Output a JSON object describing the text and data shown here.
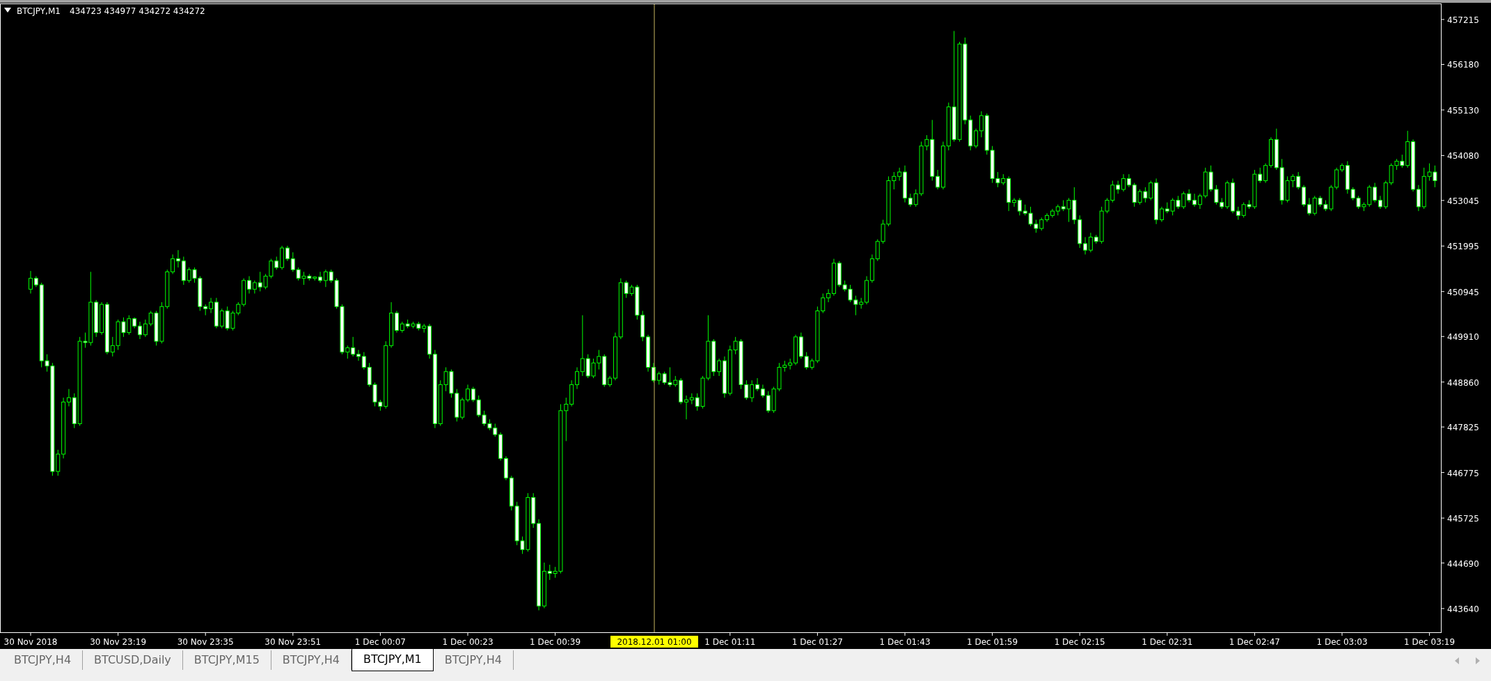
{
  "chart": {
    "symbol": "BTCJPY,M1",
    "ohlc": "434723 434977 434272 434272",
    "crosshair": {
      "time_label": "2018.12.01 01:00"
    },
    "chart_data": {
      "type": "candlestick",
      "categories": [
        "30 Nov 2018",
        null,
        null,
        null,
        null,
        null,
        null,
        null,
        null,
        null,
        null,
        null,
        null,
        null,
        null,
        null,
        "30 Nov 23:19",
        null,
        null,
        null,
        null,
        null,
        null,
        null,
        null,
        null,
        null,
        null,
        null,
        null,
        null,
        null,
        "30 Nov 23:35",
        null,
        null,
        null,
        null,
        null,
        null,
        null,
        null,
        null,
        null,
        null,
        null,
        null,
        null,
        null,
        "30 Nov 23:51",
        null,
        null,
        null,
        null,
        null,
        null,
        null,
        null,
        null,
        null,
        null,
        null,
        null,
        null,
        null,
        "1 Dec 00:07",
        null,
        null,
        null,
        null,
        null,
        null,
        null,
        null,
        null,
        null,
        null,
        null,
        null,
        null,
        null,
        "1 Dec 00:23",
        null,
        null,
        null,
        null,
        null,
        null,
        null,
        null,
        null,
        null,
        null,
        null,
        null,
        null,
        null,
        "1 Dec 00:39",
        null,
        null,
        null,
        null,
        null,
        null,
        null,
        null,
        null,
        null,
        null,
        null,
        null,
        null,
        null,
        null,
        null,
        null,
        null,
        null,
        null,
        null,
        null,
        null,
        null,
        null,
        null,
        null,
        null,
        null,
        null,
        "1 Dec 01:11",
        null,
        null,
        null,
        null,
        null,
        null,
        null,
        null,
        null,
        null,
        null,
        null,
        null,
        null,
        null,
        "1 Dec 01:27",
        null,
        null,
        null,
        null,
        null,
        null,
        null,
        null,
        null,
        null,
        null,
        null,
        null,
        null,
        null,
        "1 Dec 01:43",
        null,
        null,
        null,
        null,
        null,
        null,
        null,
        null,
        null,
        null,
        null,
        null,
        null,
        null,
        null,
        "1 Dec 01:59",
        null,
        null,
        null,
        null,
        null,
        null,
        null,
        null,
        null,
        null,
        null,
        null,
        null,
        null,
        null,
        "1 Dec 02:15",
        null,
        null,
        null,
        null,
        null,
        null,
        null,
        null,
        null,
        null,
        null,
        null,
        null,
        null,
        null,
        "1 Dec 02:31",
        null,
        null,
        null,
        null,
        null,
        null,
        null,
        null,
        null,
        null,
        null,
        null,
        null,
        null,
        null,
        "1 Dec 02:47",
        null,
        null,
        null,
        null,
        null,
        null,
        null,
        null,
        null,
        null,
        null,
        null,
        null,
        null,
        null,
        "1 Dec 03:03",
        null,
        null,
        null,
        null,
        null,
        null,
        null,
        null,
        null,
        null,
        null,
        null,
        null,
        null,
        null,
        "1 Dec 03:19",
        null
      ],
      "ohlc": [
        [
          451000,
          451420,
          450900,
          451250
        ],
        [
          451250,
          451300,
          451050,
          451100
        ],
        [
          451100,
          451150,
          449200,
          449350
        ],
        [
          449350,
          449500,
          449100,
          449230
        ],
        [
          449230,
          449300,
          446700,
          446800
        ],
        [
          446800,
          447300,
          446700,
          447200
        ],
        [
          447200,
          448500,
          447100,
          448400
        ],
        [
          448400,
          448700,
          448300,
          448500
        ],
        [
          448500,
          448600,
          447800,
          447900
        ],
        [
          447900,
          449900,
          447850,
          449800
        ],
        [
          449800,
          450000,
          449650,
          449770
        ],
        [
          449770,
          451400,
          449700,
          450700
        ],
        [
          450700,
          450750,
          449900,
          450000
        ],
        [
          450000,
          450700,
          449950,
          450650
        ],
        [
          450650,
          450700,
          449500,
          449550
        ],
        [
          449550,
          449900,
          449450,
          449700
        ],
        [
          449700,
          450300,
          449600,
          450250
        ],
        [
          450250,
          450350,
          449900,
          450000
        ],
        [
          450000,
          450400,
          449950,
          450320
        ],
        [
          450320,
          450350,
          450100,
          450150
        ],
        [
          450150,
          450250,
          449850,
          449950
        ],
        [
          449950,
          450300,
          449900,
          450200
        ],
        [
          450200,
          450500,
          450150,
          450450
        ],
        [
          450450,
          450500,
          449700,
          449800
        ],
        [
          449800,
          450700,
          449750,
          450600
        ],
        [
          450600,
          451450,
          450550,
          451400
        ],
        [
          451400,
          451800,
          451350,
          451700
        ],
        [
          451700,
          451900,
          451500,
          451650
        ],
        [
          451650,
          451750,
          451100,
          451200
        ],
        [
          451200,
          451500,
          451150,
          451450
        ],
        [
          451450,
          451500,
          451150,
          451250
        ],
        [
          451250,
          451300,
          450500,
          450600
        ],
        [
          450600,
          450650,
          450400,
          450550
        ],
        [
          450550,
          450800,
          450450,
          450700
        ],
        [
          450700,
          450800,
          450100,
          450150
        ],
        [
          450150,
          450550,
          450100,
          450500
        ],
        [
          450500,
          450600,
          450050,
          450100
        ],
        [
          450100,
          450500,
          450050,
          450450
        ],
        [
          450450,
          450700,
          450400,
          450650
        ],
        [
          450650,
          451250,
          450600,
          451200
        ],
        [
          451200,
          451300,
          450900,
          451000
        ],
        [
          451000,
          451200,
          450900,
          451150
        ],
        [
          451150,
          451400,
          450950,
          451050
        ],
        [
          451050,
          451350,
          451000,
          451300
        ],
        [
          451300,
          451700,
          451250,
          451650
        ],
        [
          451650,
          451750,
          451450,
          451500
        ],
        [
          451500,
          452000,
          451450,
          451950
        ],
        [
          451950,
          452000,
          451650,
          451700
        ],
        [
          451700,
          451850,
          451400,
          451450
        ],
        [
          451450,
          451500,
          451200,
          451250
        ],
        [
          451250,
          451400,
          451100,
          451300
        ],
        [
          451300,
          451350,
          451200,
          451250
        ],
        [
          451250,
          451300,
          451200,
          451280
        ],
        [
          451280,
          451400,
          451150,
          451200
        ],
        [
          451200,
          451450,
          451050,
          451400
        ],
        [
          451400,
          451450,
          451150,
          451200
        ],
        [
          451200,
          451250,
          450550,
          450600
        ],
        [
          450600,
          450650,
          449500,
          449550
        ],
        [
          449550,
          449700,
          449400,
          449650
        ],
        [
          449650,
          449900,
          449450,
          449500
        ],
        [
          449500,
          449600,
          449350,
          449450
        ],
        [
          449450,
          449550,
          449150,
          449200
        ],
        [
          449200,
          449300,
          448750,
          448800
        ],
        [
          448800,
          448850,
          448300,
          448400
        ],
        [
          448400,
          448450,
          448200,
          448300
        ],
        [
          448300,
          449800,
          448250,
          449700
        ],
        [
          449700,
          450700,
          449650,
          450450
        ],
        [
          450450,
          450500,
          450000,
          450050
        ],
        [
          450050,
          450250,
          450000,
          450200
        ],
        [
          450200,
          450300,
          450100,
          450150
        ],
        [
          450150,
          450250,
          450100,
          450200
        ],
        [
          450200,
          450250,
          450050,
          450100
        ],
        [
          450100,
          450200,
          450000,
          450150
        ],
        [
          450150,
          450200,
          449400,
          449500
        ],
        [
          449500,
          449600,
          447800,
          447900
        ],
        [
          447900,
          448900,
          447850,
          448800
        ],
        [
          448800,
          449200,
          448650,
          449100
        ],
        [
          449100,
          449150,
          448500,
          448600
        ],
        [
          448600,
          448700,
          447950,
          448050
        ],
        [
          448050,
          448500,
          448000,
          448450
        ],
        [
          448450,
          448800,
          448400,
          448700
        ],
        [
          448700,
          448750,
          448400,
          448450
        ],
        [
          448450,
          448550,
          448050,
          448100
        ],
        [
          448100,
          448200,
          447850,
          447900
        ],
        [
          447900,
          448000,
          447750,
          447800
        ],
        [
          447800,
          447900,
          447600,
          447650
        ],
        [
          447650,
          447700,
          447050,
          447100
        ],
        [
          447100,
          447150,
          446600,
          446650
        ],
        [
          446650,
          446700,
          445900,
          446000
        ],
        [
          446000,
          446100,
          445100,
          445200
        ],
        [
          445200,
          445300,
          444900,
          445000
        ],
        [
          445000,
          446300,
          444950,
          446200
        ],
        [
          446200,
          446300,
          445500,
          445600
        ],
        [
          445600,
          445700,
          443600,
          443700
        ],
        [
          443700,
          444700,
          443650,
          444500
        ],
        [
          444500,
          444650,
          444300,
          444450
        ],
        [
          444450,
          444600,
          444350,
          444500
        ],
        [
          444500,
          448350,
          444450,
          448200
        ],
        [
          448200,
          448500,
          447500,
          448350
        ],
        [
          448350,
          448900,
          448300,
          448800
        ],
        [
          448800,
          449200,
          448700,
          449100
        ],
        [
          449100,
          450400,
          449000,
          449400
        ],
        [
          449400,
          449500,
          448950,
          449000
        ],
        [
          449000,
          449400,
          448950,
          449300
        ],
        [
          449300,
          449600,
          449150,
          449450
        ],
        [
          449450,
          449500,
          448750,
          448800
        ],
        [
          448800,
          449000,
          448750,
          448950
        ],
        [
          448950,
          450000,
          448900,
          449900
        ],
        [
          449900,
          451250,
          449850,
          451150
        ],
        [
          451150,
          451200,
          450800,
          450900
        ],
        [
          450900,
          451100,
          450850,
          451050
        ],
        [
          451050,
          451100,
          450300,
          450400
        ],
        [
          450400,
          450500,
          449800,
          449900
        ],
        [
          449900,
          449950,
          449100,
          449200
        ],
        [
          449200,
          449300,
          448850,
          448900
        ],
        [
          448900,
          449100,
          448800,
          449050
        ],
        [
          449050,
          449100,
          448800,
          448850
        ],
        [
          448850,
          449200,
          448750,
          448800
        ],
        [
          448800,
          449000,
          448750,
          448900
        ],
        [
          448900,
          448950,
          448350,
          448400
        ],
        [
          448400,
          448550,
          448000,
          448450
        ],
        [
          448450,
          448600,
          448350,
          448500
        ],
        [
          448500,
          448600,
          448200,
          448300
        ],
        [
          448300,
          449000,
          448250,
          448950
        ],
        [
          448950,
          450400,
          448900,
          449800
        ],
        [
          449800,
          449850,
          449000,
          449100
        ],
        [
          449100,
          449400,
          449000,
          449350
        ],
        [
          449350,
          449450,
          448500,
          448600
        ],
        [
          448600,
          449700,
          448550,
          449600
        ],
        [
          449600,
          449900,
          449500,
          449800
        ],
        [
          449800,
          449850,
          448700,
          448800
        ],
        [
          448800,
          448900,
          448450,
          448500
        ],
        [
          448500,
          448900,
          448400,
          448800
        ],
        [
          448800,
          448950,
          448650,
          448700
        ],
        [
          448700,
          448800,
          448500,
          448550
        ],
        [
          448550,
          448650,
          448150,
          448200
        ],
        [
          448200,
          448750,
          448150,
          448700
        ],
        [
          448700,
          449300,
          448650,
          449200
        ],
        [
          449200,
          449350,
          449100,
          449250
        ],
        [
          449250,
          449400,
          449150,
          449300
        ],
        [
          449300,
          449950,
          449250,
          449900
        ],
        [
          449900,
          450000,
          449400,
          449450
        ],
        [
          449450,
          449550,
          449150,
          449200
        ],
        [
          449200,
          449400,
          449150,
          449350
        ],
        [
          449350,
          450600,
          449300,
          450500
        ],
        [
          450500,
          450900,
          450450,
          450800
        ],
        [
          450800,
          451000,
          450700,
          450900
        ],
        [
          450900,
          451700,
          450850,
          451600
        ],
        [
          451600,
          451650,
          451050,
          451100
        ],
        [
          451100,
          451200,
          450950,
          451000
        ],
        [
          451000,
          451100,
          450700,
          450750
        ],
        [
          450750,
          450850,
          450400,
          450650
        ],
        [
          450650,
          450800,
          450550,
          450700
        ],
        [
          450700,
          451300,
          450650,
          451200
        ],
        [
          451200,
          451800,
          451150,
          451700
        ],
        [
          451700,
          452150,
          451650,
          452100
        ],
        [
          452100,
          452600,
          452050,
          452500
        ],
        [
          452500,
          453600,
          452450,
          453500
        ],
        [
          453500,
          453700,
          453300,
          453600
        ],
        [
          453600,
          453800,
          453500,
          453700
        ],
        [
          453700,
          453850,
          453000,
          453100
        ],
        [
          453100,
          453200,
          452900,
          452950
        ],
        [
          452950,
          453300,
          452900,
          453200
        ],
        [
          453200,
          454400,
          453150,
          454300
        ],
        [
          454300,
          454550,
          454200,
          454450
        ],
        [
          454450,
          454900,
          453500,
          453600
        ],
        [
          453600,
          453750,
          453300,
          453350
        ],
        [
          453350,
          454400,
          453300,
          454300
        ],
        [
          454300,
          455300,
          454200,
          455200
        ],
        [
          455200,
          456950,
          454400,
          454450
        ],
        [
          454450,
          456700,
          454400,
          456650
        ],
        [
          456650,
          456800,
          454800,
          454900
        ],
        [
          454900,
          455000,
          454200,
          454300
        ],
        [
          454300,
          454700,
          454250,
          454650
        ],
        [
          454650,
          455100,
          454500,
          455000
        ],
        [
          455000,
          455050,
          454100,
          454200
        ],
        [
          454200,
          454300,
          453450,
          453550
        ],
        [
          453550,
          453700,
          453350,
          453450
        ],
        [
          453450,
          453650,
          453400,
          453550
        ],
        [
          453550,
          453600,
          452800,
          453000
        ],
        [
          453000,
          453100,
          452900,
          453050
        ],
        [
          453050,
          453100,
          452700,
          452800
        ],
        [
          452800,
          452950,
          452700,
          452750
        ],
        [
          452750,
          452900,
          452450,
          452500
        ],
        [
          452500,
          452600,
          452300,
          452400
        ],
        [
          452400,
          452650,
          452350,
          452600
        ],
        [
          452600,
          452750,
          452550,
          452700
        ],
        [
          452700,
          452850,
          452650,
          452800
        ],
        [
          452800,
          452950,
          452700,
          452900
        ],
        [
          452900,
          453050,
          452800,
          452850
        ],
        [
          452850,
          453100,
          452550,
          453050
        ],
        [
          453050,
          453350,
          452500,
          452600
        ],
        [
          452600,
          452700,
          451950,
          452050
        ],
        [
          452050,
          452200,
          451800,
          451900
        ],
        [
          451900,
          452300,
          451850,
          452200
        ],
        [
          452200,
          452250,
          452050,
          452100
        ],
        [
          452100,
          452900,
          452050,
          452800
        ],
        [
          452800,
          453100,
          452750,
          453050
        ],
        [
          453050,
          453500,
          453000,
          453400
        ],
        [
          453400,
          453500,
          453200,
          453300
        ],
        [
          453300,
          453650,
          453250,
          453550
        ],
        [
          453550,
          453650,
          453350,
          453400
        ],
        [
          453400,
          453450,
          452900,
          453000
        ],
        [
          453000,
          453300,
          452950,
          453250
        ],
        [
          453250,
          453350,
          453000,
          453100
        ],
        [
          453100,
          453500,
          453050,
          453450
        ],
        [
          453450,
          453550,
          452500,
          452600
        ],
        [
          452600,
          452900,
          452550,
          452850
        ],
        [
          452850,
          453000,
          452750,
          452800
        ],
        [
          452800,
          453100,
          452700,
          453050
        ],
        [
          453050,
          453150,
          452850,
          452900
        ],
        [
          452900,
          453250,
          452850,
          453200
        ],
        [
          453200,
          453300,
          453000,
          453050
        ],
        [
          453050,
          453200,
          452900,
          452950
        ],
        [
          452950,
          453200,
          452850,
          453150
        ],
        [
          453150,
          453800,
          453100,
          453700
        ],
        [
          453700,
          453850,
          453250,
          453300
        ],
        [
          453300,
          453400,
          452950,
          453000
        ],
        [
          453000,
          453100,
          452850,
          452900
        ],
        [
          452900,
          453500,
          452850,
          453450
        ],
        [
          453450,
          453550,
          452750,
          452800
        ],
        [
          452800,
          452900,
          452600,
          452700
        ],
        [
          452700,
          453000,
          452650,
          452950
        ],
        [
          452950,
          453050,
          452850,
          452900
        ],
        [
          452900,
          453750,
          452850,
          453650
        ],
        [
          453650,
          453800,
          453450,
          453500
        ],
        [
          453500,
          453900,
          453450,
          453850
        ],
        [
          453850,
          454500,
          453800,
          454450
        ],
        [
          454450,
          454700,
          453750,
          453800
        ],
        [
          453800,
          454000,
          452950,
          453050
        ],
        [
          453050,
          453600,
          453000,
          453500
        ],
        [
          453500,
          453650,
          453350,
          453600
        ],
        [
          453600,
          453700,
          453300,
          453350
        ],
        [
          453350,
          453400,
          452900,
          452950
        ],
        [
          452950,
          453100,
          452700,
          452750
        ],
        [
          452750,
          453150,
          452700,
          453100
        ],
        [
          453100,
          453150,
          452900,
          452950
        ],
        [
          452950,
          453050,
          452800,
          452850
        ],
        [
          452850,
          453400,
          452800,
          453350
        ],
        [
          453350,
          453800,
          453300,
          453750
        ],
        [
          453750,
          453900,
          453700,
          453850
        ],
        [
          453850,
          453950,
          453200,
          453300
        ],
        [
          453300,
          453350,
          453050,
          453100
        ],
        [
          453100,
          453150,
          452850,
          452900
        ],
        [
          452900,
          453000,
          452800,
          452950
        ],
        [
          452950,
          453400,
          452900,
          453350
        ],
        [
          453350,
          453450,
          453000,
          453050
        ],
        [
          453050,
          453150,
          452850,
          452900
        ],
        [
          452900,
          453500,
          452850,
          453450
        ],
        [
          453450,
          453900,
          453400,
          453850
        ],
        [
          453850,
          454000,
          453750,
          453950
        ],
        [
          453950,
          454100,
          453800,
          453850
        ],
        [
          453850,
          454650,
          453800,
          454400
        ],
        [
          454400,
          454450,
          453250,
          453300
        ],
        [
          453300,
          453400,
          452800,
          452900
        ],
        [
          452900,
          453800,
          452850,
          453600
        ],
        [
          453600,
          453900,
          453500,
          453700
        ],
        [
          453700,
          453850,
          453350,
          453500
        ]
      ],
      "ylim": [
        443094,
        457568
      ],
      "yticks": [
        457215,
        456180,
        455130,
        454080,
        453045,
        451995,
        450945,
        449910,
        448860,
        447825,
        446775,
        445725,
        444690,
        443640
      ]
    }
  },
  "tabs": [
    {
      "label": "BTCJPY,H4",
      "selected": false
    },
    {
      "label": "BTCUSD,Daily",
      "selected": false
    },
    {
      "label": "BTCJPY,M15",
      "selected": false
    },
    {
      "label": "BTCJPY,H4",
      "selected": false
    },
    {
      "label": "BTCJPY,M1",
      "selected": true
    },
    {
      "label": "BTCJPY,H4",
      "selected": false
    }
  ]
}
